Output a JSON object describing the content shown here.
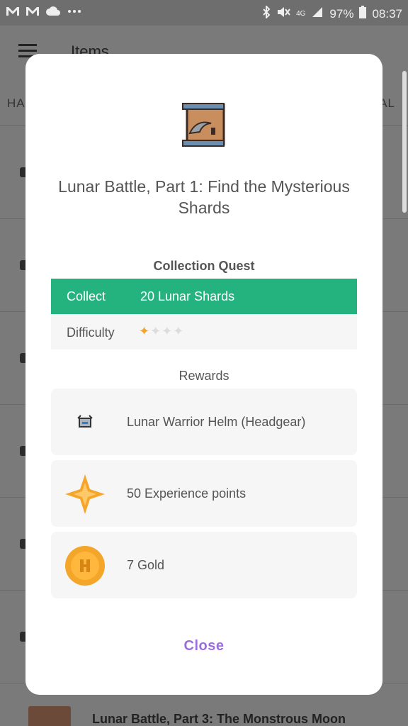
{
  "status_bar": {
    "left_icons": [
      "gmail-icon",
      "gmail-icon",
      "cloud-icon",
      "more-icon"
    ],
    "network": "4G",
    "battery": "97%",
    "time": "08:37"
  },
  "app": {
    "title": "Items",
    "tabs": [
      "HA",
      "AL"
    ],
    "bottom_item_title": "Lunar Battle, Part 3: The Monstrous Moon"
  },
  "dialog": {
    "title": "Lunar Battle, Part 1: Find the Mysterious Shards",
    "quest_type": "Collection Quest",
    "collect_label": "Collect",
    "collect_value": "20 Lunar Shards",
    "difficulty_label": "Difficulty",
    "difficulty": {
      "rating": 1,
      "max": 4
    },
    "rewards_heading": "Rewards",
    "rewards": [
      {
        "icon": "helm-icon",
        "text": "Lunar Warrior Helm (Headgear)"
      },
      {
        "icon": "experience-star-icon",
        "text": "50 Experience points"
      },
      {
        "icon": "gold-coin-icon",
        "text": "7 Gold"
      }
    ],
    "close_label": "Close"
  },
  "colors": {
    "accent_green": "#24b37e",
    "close_purple": "#9b6fdb",
    "star_gold": "#f4a62a",
    "coin_orange": "#f4a62a"
  }
}
